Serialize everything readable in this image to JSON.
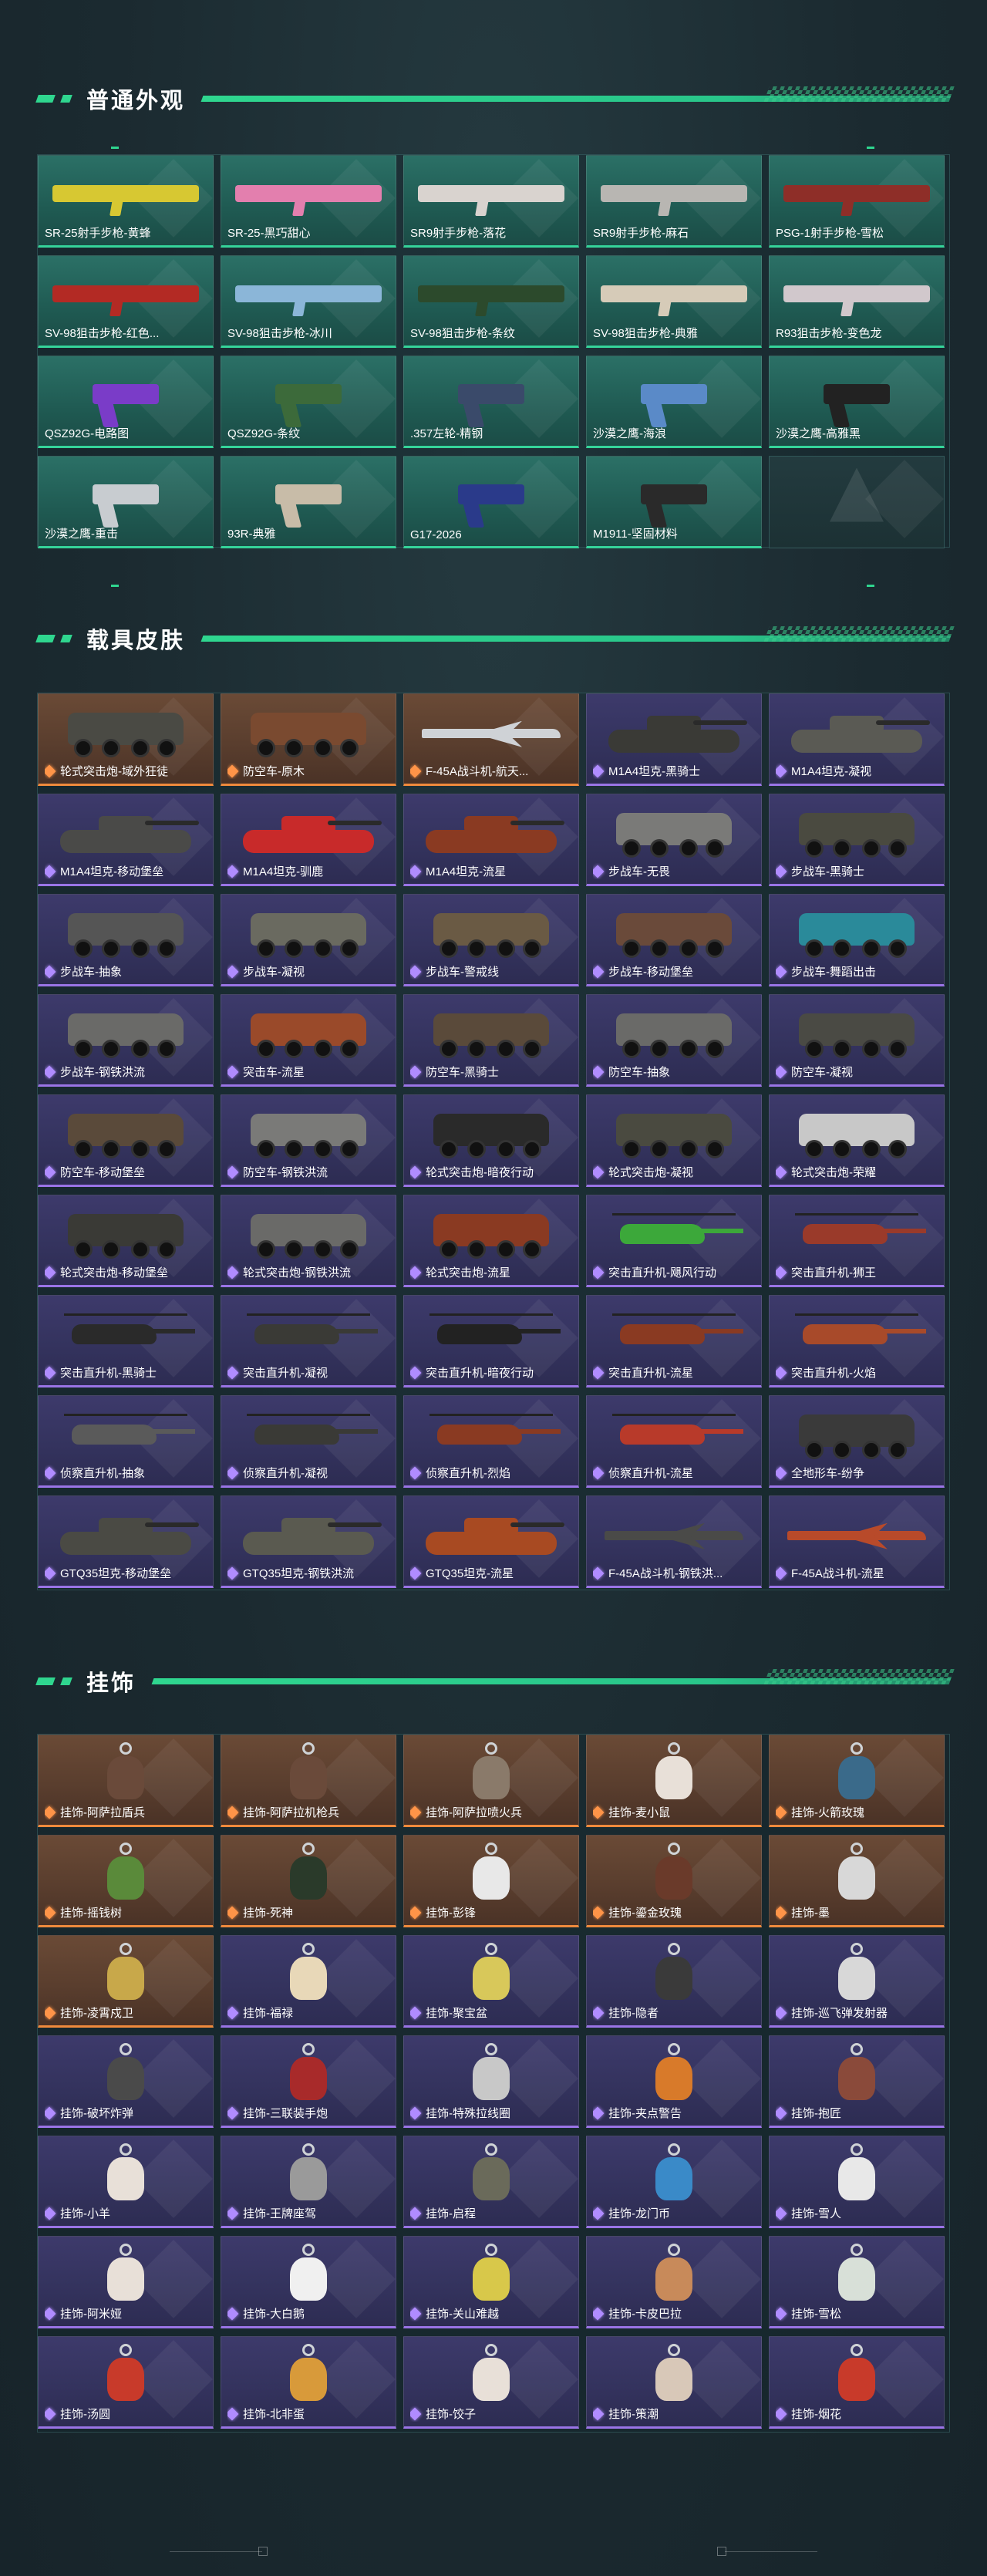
{
  "sections": [
    {
      "title": "普通外观",
      "rows": 4,
      "items": [
        {
          "label": "SR-25射手步枪-黄蜂",
          "rarity": "green",
          "art": "rifle",
          "color": "#d7c832"
        },
        {
          "label": "SR-25-黑巧甜心",
          "rarity": "green",
          "art": "rifle",
          "color": "#e37fae"
        },
        {
          "label": "SR9射手步枪-落花",
          "rarity": "green",
          "art": "rifle",
          "color": "#d9d3cf"
        },
        {
          "label": "SR9射手步枪-麻石",
          "rarity": "green",
          "art": "rifle",
          "color": "#b8b6b2"
        },
        {
          "label": "PSG-1射手步枪-雪松",
          "rarity": "green",
          "art": "rifle",
          "color": "#8e2e28"
        },
        {
          "label": "SV-98狙击步枪-红色...",
          "rarity": "green",
          "art": "rifle",
          "color": "#b32a24"
        },
        {
          "label": "SV-98狙击步枪-冰川",
          "rarity": "green",
          "art": "rifle",
          "color": "#8bb6d8"
        },
        {
          "label": "SV-98狙击步枪-条纹",
          "rarity": "green",
          "art": "rifle",
          "color": "#2c4a2c"
        },
        {
          "label": "SV-98狙击步枪-典雅",
          "rarity": "green",
          "art": "rifle",
          "color": "#d6cbb8"
        },
        {
          "label": "R93狙击步枪-变色龙",
          "rarity": "green",
          "art": "rifle",
          "color": "#d1c8cc"
        },
        {
          "label": "QSZ92G-电路图",
          "rarity": "green",
          "art": "pistol",
          "color": "#7a3cc8"
        },
        {
          "label": "QSZ92G-条纹",
          "rarity": "green",
          "art": "pistol",
          "color": "#3c6a3a"
        },
        {
          "label": ".357左轮-精钢",
          "rarity": "green",
          "art": "pistol",
          "color": "#3a4a6a"
        },
        {
          "label": "沙漠之鹰-海浪",
          "rarity": "green",
          "art": "pistol",
          "color": "#5a8ac8"
        },
        {
          "label": "沙漠之鹰-高雅黑",
          "rarity": "green",
          "art": "pistol",
          "color": "#222222"
        },
        {
          "label": "沙漠之鹰-重击",
          "rarity": "green",
          "art": "pistol",
          "color": "#c8ccd0"
        },
        {
          "label": "93R-典雅",
          "rarity": "green",
          "art": "pistol",
          "color": "#c8bca8"
        },
        {
          "label": "G17-2026",
          "rarity": "green",
          "art": "pistol",
          "color": "#2a3a8a"
        },
        {
          "label": "M1911-坚固材料",
          "rarity": "green",
          "art": "pistol",
          "color": "#2a2a2a"
        },
        {
          "label": "",
          "rarity": "empty",
          "art": "none",
          "color": ""
        }
      ]
    },
    {
      "title": "载具皮肤",
      "rows": 9,
      "items": [
        {
          "label": "轮式突击炮-域外狂徒",
          "rarity": "orange",
          "art": "apc",
          "color": "#4a4a44"
        },
        {
          "label": "防空车-原木",
          "rarity": "orange",
          "art": "apc",
          "color": "#7a4a30"
        },
        {
          "label": "F-45A战斗机-航天...",
          "rarity": "orange",
          "art": "jet",
          "color": "#cfd2d6"
        },
        {
          "label": "M1A4坦克-黑骑士",
          "rarity": "purple",
          "art": "tank",
          "color": "#3a3a36"
        },
        {
          "label": "M1A4坦克-凝视",
          "rarity": "purple",
          "art": "tank",
          "color": "#5a5a54"
        },
        {
          "label": "M1A4坦克-移动堡垒",
          "rarity": "purple",
          "art": "tank",
          "color": "#4a4a48"
        },
        {
          "label": "M1A4坦克-驯鹿",
          "rarity": "purple",
          "art": "tank",
          "color": "#c82a2a"
        },
        {
          "label": "M1A4坦克-流星",
          "rarity": "purple",
          "art": "tank",
          "color": "#8a3a22"
        },
        {
          "label": "步战车-无畏",
          "rarity": "purple",
          "art": "apc",
          "color": "#7a7a78"
        },
        {
          "label": "步战车-黑骑士",
          "rarity": "purple",
          "art": "apc",
          "color": "#4a4a40"
        },
        {
          "label": "步战车-抽象",
          "rarity": "purple",
          "art": "apc",
          "color": "#555555"
        },
        {
          "label": "步战车-凝视",
          "rarity": "purple",
          "art": "apc",
          "color": "#6a6a60"
        },
        {
          "label": "步战车-警戒线",
          "rarity": "purple",
          "art": "apc",
          "color": "#6a5a44"
        },
        {
          "label": "步战车-移动堡垒",
          "rarity": "purple",
          "art": "apc",
          "color": "#6a4a3a"
        },
        {
          "label": "步战车-舞蹈出击",
          "rarity": "purple",
          "art": "apc",
          "color": "#2a8a9a"
        },
        {
          "label": "步战车-钢铁洪流",
          "rarity": "purple",
          "art": "apc",
          "color": "#6a6a68"
        },
        {
          "label": "突击车-流星",
          "rarity": "purple",
          "art": "apc",
          "color": "#9a4a2a"
        },
        {
          "label": "防空车-黑骑士",
          "rarity": "purple",
          "art": "apc",
          "color": "#5a4a3a"
        },
        {
          "label": "防空车-抽象",
          "rarity": "purple",
          "art": "apc",
          "color": "#6a6a68"
        },
        {
          "label": "防空车-凝视",
          "rarity": "purple",
          "art": "apc",
          "color": "#4a4a44"
        },
        {
          "label": "防空车-移动堡垒",
          "rarity": "purple",
          "art": "apc",
          "color": "#5a4a3a"
        },
        {
          "label": "防空车-钢铁洪流",
          "rarity": "purple",
          "art": "apc",
          "color": "#7a7a78"
        },
        {
          "label": "轮式突击炮-暗夜行动",
          "rarity": "purple",
          "art": "apc",
          "color": "#2a2a2a"
        },
        {
          "label": "轮式突击炮-凝视",
          "rarity": "purple",
          "art": "apc",
          "color": "#4a4a40"
        },
        {
          "label": "轮式突击炮-荣耀",
          "rarity": "purple",
          "art": "apc",
          "color": "#c8c8c8"
        },
        {
          "label": "轮式突击炮-移动堡垒",
          "rarity": "purple",
          "art": "apc",
          "color": "#3a3a36"
        },
        {
          "label": "轮式突击炮-钢铁洪流",
          "rarity": "purple",
          "art": "apc",
          "color": "#6a6a68"
        },
        {
          "label": "轮式突击炮-流星",
          "rarity": "purple",
          "art": "apc",
          "color": "#8a3a22"
        },
        {
          "label": "突击直升机-飓风行动",
          "rarity": "purple",
          "art": "heli",
          "color": "#3ca83a"
        },
        {
          "label": "突击直升机-狮王",
          "rarity": "purple",
          "art": "heli",
          "color": "#9a3a2a"
        },
        {
          "label": "突击直升机-黑骑士",
          "rarity": "purple",
          "art": "heli",
          "color": "#2a2a2a"
        },
        {
          "label": "突击直升机-凝视",
          "rarity": "purple",
          "art": "heli",
          "color": "#3a3a36"
        },
        {
          "label": "突击直升机-暗夜行动",
          "rarity": "purple",
          "art": "heli",
          "color": "#222222"
        },
        {
          "label": "突击直升机-流星",
          "rarity": "purple",
          "art": "heli",
          "color": "#8a3a22"
        },
        {
          "label": "突击直升机-火焰",
          "rarity": "purple",
          "art": "heli",
          "color": "#a84a2a"
        },
        {
          "label": "侦察直升机-抽象",
          "rarity": "purple",
          "art": "heli",
          "color": "#5a5a5a"
        },
        {
          "label": "侦察直升机-凝视",
          "rarity": "purple",
          "art": "heli",
          "color": "#3a3a36"
        },
        {
          "label": "侦察直升机-烈焰",
          "rarity": "purple",
          "art": "heli",
          "color": "#8a3a22"
        },
        {
          "label": "侦察直升机-流星",
          "rarity": "purple",
          "art": "heli",
          "color": "#b83a2a"
        },
        {
          "label": "全地形车-纷争",
          "rarity": "purple",
          "art": "apc",
          "color": "#3a3a3a"
        },
        {
          "label": "GTQ35坦克-移动堡垒",
          "rarity": "purple",
          "art": "tank",
          "color": "#4a4a44"
        },
        {
          "label": "GTQ35坦克-钢铁洪流",
          "rarity": "purple",
          "art": "tank",
          "color": "#5a5a50"
        },
        {
          "label": "GTQ35坦克-流星",
          "rarity": "purple",
          "art": "tank",
          "color": "#a84a22"
        },
        {
          "label": "F-45A战斗机-钢铁洪...",
          "rarity": "purple",
          "art": "jet",
          "color": "#4a4a48"
        },
        {
          "label": "F-45A战斗机-流星",
          "rarity": "purple",
          "art": "jet",
          "color": "#b84a2a"
        }
      ]
    },
    {
      "title": "挂饰",
      "rows": 7,
      "items": [
        {
          "label": "挂饰-阿萨拉盾兵",
          "rarity": "orange",
          "art": "charm",
          "color": "#6a4a3a"
        },
        {
          "label": "挂饰-阿萨拉机枪兵",
          "rarity": "orange",
          "art": "charm",
          "color": "#6a4a3a"
        },
        {
          "label": "挂饰-阿萨拉喷火兵",
          "rarity": "orange",
          "art": "charm",
          "color": "#8a7a6a"
        },
        {
          "label": "挂饰-麦小鼠",
          "rarity": "orange",
          "art": "charm",
          "color": "#e8e0d8"
        },
        {
          "label": "挂饰-火箭玫瑰",
          "rarity": "orange",
          "art": "charm",
          "color": "#3a6a8a"
        },
        {
          "label": "挂饰-摇钱树",
          "rarity": "orange",
          "art": "charm",
          "color": "#5a8a3a"
        },
        {
          "label": "挂饰-死神",
          "rarity": "orange",
          "art": "charm",
          "color": "#2a3a2a"
        },
        {
          "label": "挂饰-彭锋",
          "rarity": "orange",
          "art": "charm",
          "color": "#e8e8e8"
        },
        {
          "label": "挂饰-鎏金玫瑰",
          "rarity": "orange",
          "art": "charm",
          "color": "#6a3a2a"
        },
        {
          "label": "挂饰-墨",
          "rarity": "orange",
          "art": "charm",
          "color": "#d8d8d8"
        },
        {
          "label": "挂饰-凌霄戍卫",
          "rarity": "orange",
          "art": "charm",
          "color": "#c8a84a"
        },
        {
          "label": "挂饰-福禄",
          "rarity": "purple",
          "art": "charm",
          "color": "#e8d8b8"
        },
        {
          "label": "挂饰-聚宝盆",
          "rarity": "purple",
          "art": "charm",
          "color": "#d8c85a"
        },
        {
          "label": "挂饰-隐者",
          "rarity": "purple",
          "art": "charm",
          "color": "#3a3a3a"
        },
        {
          "label": "挂饰-巡飞弹发射器",
          "rarity": "purple",
          "art": "charm",
          "color": "#d8d8d8"
        },
        {
          "label": "挂饰-破坏炸弹",
          "rarity": "purple",
          "art": "charm",
          "color": "#4a4a4a"
        },
        {
          "label": "挂饰-三联装手炮",
          "rarity": "purple",
          "art": "charm",
          "color": "#a82a2a"
        },
        {
          "label": "挂饰-特殊拉线圈",
          "rarity": "purple",
          "art": "charm",
          "color": "#c8c8c8"
        },
        {
          "label": "挂饰-夹点警告",
          "rarity": "purple",
          "art": "charm",
          "color": "#d87a2a"
        },
        {
          "label": "挂饰-抱匠",
          "rarity": "purple",
          "art": "charm",
          "color": "#8a4a3a"
        },
        {
          "label": "挂饰-小羊",
          "rarity": "purple",
          "art": "charm",
          "color": "#e8e0d8"
        },
        {
          "label": "挂饰-王牌座驾",
          "rarity": "purple",
          "art": "charm",
          "color": "#9a9a9a"
        },
        {
          "label": "挂饰-启程",
          "rarity": "purple",
          "art": "charm",
          "color": "#6a6a5a"
        },
        {
          "label": "挂饰-龙门币",
          "rarity": "purple",
          "art": "charm",
          "color": "#3a8ac8"
        },
        {
          "label": "挂饰-雪人",
          "rarity": "purple",
          "art": "charm",
          "color": "#e8e8e8"
        },
        {
          "label": "挂饰-阿米娅",
          "rarity": "purple",
          "art": "charm",
          "color": "#e8e0d8"
        },
        {
          "label": "挂饰-大白鹅",
          "rarity": "purple",
          "art": "charm",
          "color": "#f0f0f0"
        },
        {
          "label": "挂饰-关山难越",
          "rarity": "purple",
          "art": "charm",
          "color": "#d8c84a"
        },
        {
          "label": "挂饰-卡皮巴拉",
          "rarity": "purple",
          "art": "charm",
          "color": "#c88a5a"
        },
        {
          "label": "挂饰-雪松",
          "rarity": "purple",
          "art": "charm",
          "color": "#d8e0d8"
        },
        {
          "label": "挂饰-汤圆",
          "rarity": "purple",
          "art": "charm",
          "color": "#c83a2a"
        },
        {
          "label": "挂饰-北非蛋",
          "rarity": "purple",
          "art": "charm",
          "color": "#d89a3a"
        },
        {
          "label": "挂饰-饺子",
          "rarity": "purple",
          "art": "charm",
          "color": "#e8e0d8"
        },
        {
          "label": "挂饰-策潮",
          "rarity": "purple",
          "art": "charm",
          "color": "#d8c8b8"
        },
        {
          "label": "挂饰-烟花",
          "rarity": "purple",
          "art": "charm",
          "color": "#c83a2a"
        }
      ]
    }
  ]
}
